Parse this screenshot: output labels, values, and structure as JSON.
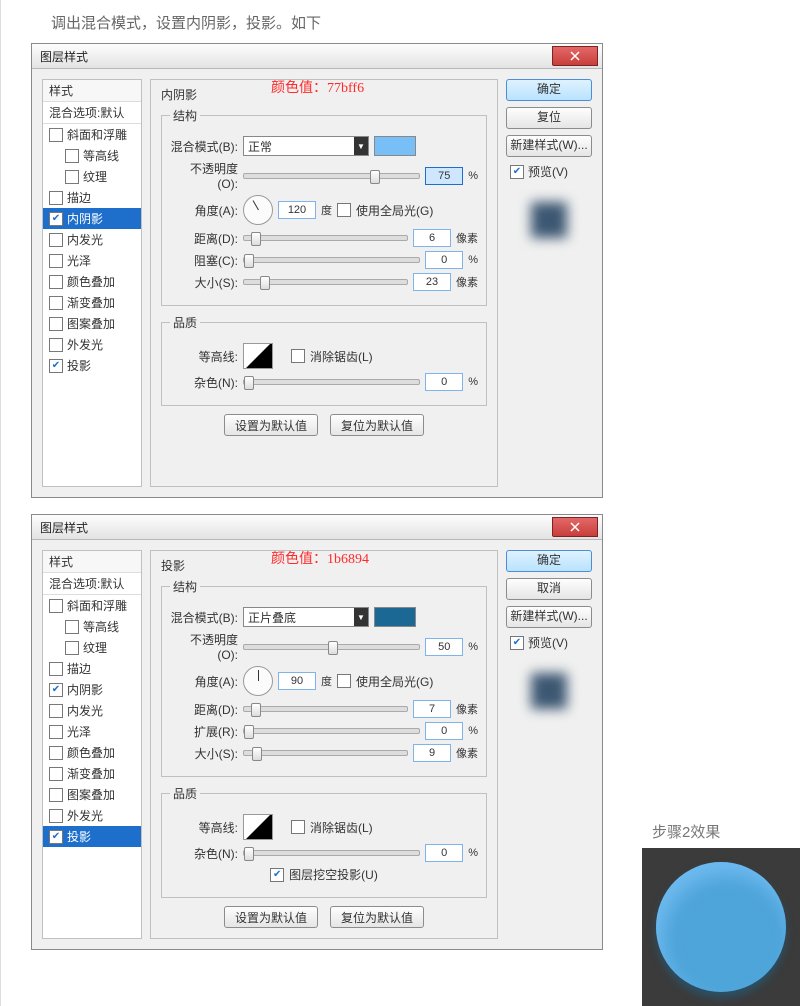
{
  "page_caption": "调出混合模式，设置内阴影，投影。如下",
  "dialog1": {
    "title": "图层样式",
    "color_note": "颜色值：77bff6",
    "swatch_color": "#77bff6",
    "styles_header": "样式",
    "styles_sub": "混合选项:默认",
    "style_list": [
      {
        "label": "斜面和浮雕",
        "checked": false
      },
      {
        "label": "等高线",
        "checked": false,
        "indent": true
      },
      {
        "label": "纹理",
        "checked": false,
        "indent": true
      },
      {
        "label": "描边",
        "checked": false
      },
      {
        "label": "内阴影",
        "checked": true,
        "selected": true
      },
      {
        "label": "内发光",
        "checked": false
      },
      {
        "label": "光泽",
        "checked": false
      },
      {
        "label": "颜色叠加",
        "checked": false
      },
      {
        "label": "渐变叠加",
        "checked": false
      },
      {
        "label": "图案叠加",
        "checked": false
      },
      {
        "label": "外发光",
        "checked": false
      },
      {
        "label": "投影",
        "checked": true
      }
    ],
    "panel_title": "内阴影",
    "struct_legend": "结构",
    "blend_mode_label": "混合模式(B):",
    "blend_mode_value": "正常",
    "opacity_label": "不透明度(O):",
    "opacity_value": "75",
    "angle_label": "角度(A):",
    "angle_value": "120",
    "angle_unit": "度",
    "global_light": "使用全局光(G)",
    "distance_label": "距离(D):",
    "distance_value": "6",
    "px": "像素",
    "choke_label": "阻塞(C):",
    "choke_value": "0",
    "pct": "%",
    "size_label": "大小(S):",
    "size_value": "23",
    "quality_legend": "品质",
    "contour_label": "等高线:",
    "anti_alias": "消除锯齿(L)",
    "noise_label": "杂色(N):",
    "noise_value": "0",
    "btn_default": "设置为默认值",
    "btn_reset": "复位为默认值",
    "side": {
      "ok": "确定",
      "reset": "复位",
      "new_style": "新建样式(W)...",
      "preview": "预览(V)"
    }
  },
  "dialog2": {
    "title": "图层样式",
    "color_note": "颜色值：1b6894",
    "swatch_color": "#1b6894",
    "styles_header": "样式",
    "styles_sub": "混合选项:默认",
    "style_list": [
      {
        "label": "斜面和浮雕",
        "checked": false
      },
      {
        "label": "等高线",
        "checked": false,
        "indent": true
      },
      {
        "label": "纹理",
        "checked": false,
        "indent": true
      },
      {
        "label": "描边",
        "checked": false
      },
      {
        "label": "内阴影",
        "checked": true
      },
      {
        "label": "内发光",
        "checked": false
      },
      {
        "label": "光泽",
        "checked": false
      },
      {
        "label": "颜色叠加",
        "checked": false
      },
      {
        "label": "渐变叠加",
        "checked": false
      },
      {
        "label": "图案叠加",
        "checked": false
      },
      {
        "label": "外发光",
        "checked": false
      },
      {
        "label": "投影",
        "checked": true,
        "selected": true
      }
    ],
    "panel_title": "投影",
    "struct_legend": "结构",
    "blend_mode_label": "混合模式(B):",
    "blend_mode_value": "正片叠底",
    "opacity_label": "不透明度(O):",
    "opacity_value": "50",
    "angle_label": "角度(A):",
    "angle_value": "90",
    "angle_unit": "度",
    "global_light": "使用全局光(G)",
    "distance_label": "距离(D):",
    "distance_value": "7",
    "px": "像素",
    "spread_label": "扩展(R):",
    "spread_value": "0",
    "pct": "%",
    "size_label": "大小(S):",
    "size_value": "9",
    "quality_legend": "品质",
    "contour_label": "等高线:",
    "anti_alias": "消除锯齿(L)",
    "noise_label": "杂色(N):",
    "noise_value": "0",
    "knockout": "图层挖空投影(U)",
    "btn_default": "设置为默认值",
    "btn_reset": "复位为默认值",
    "side": {
      "ok": "确定",
      "cancel": "取消",
      "new_style": "新建样式(W)...",
      "preview": "预览(V)"
    }
  },
  "step2_label": "步骤2效果"
}
